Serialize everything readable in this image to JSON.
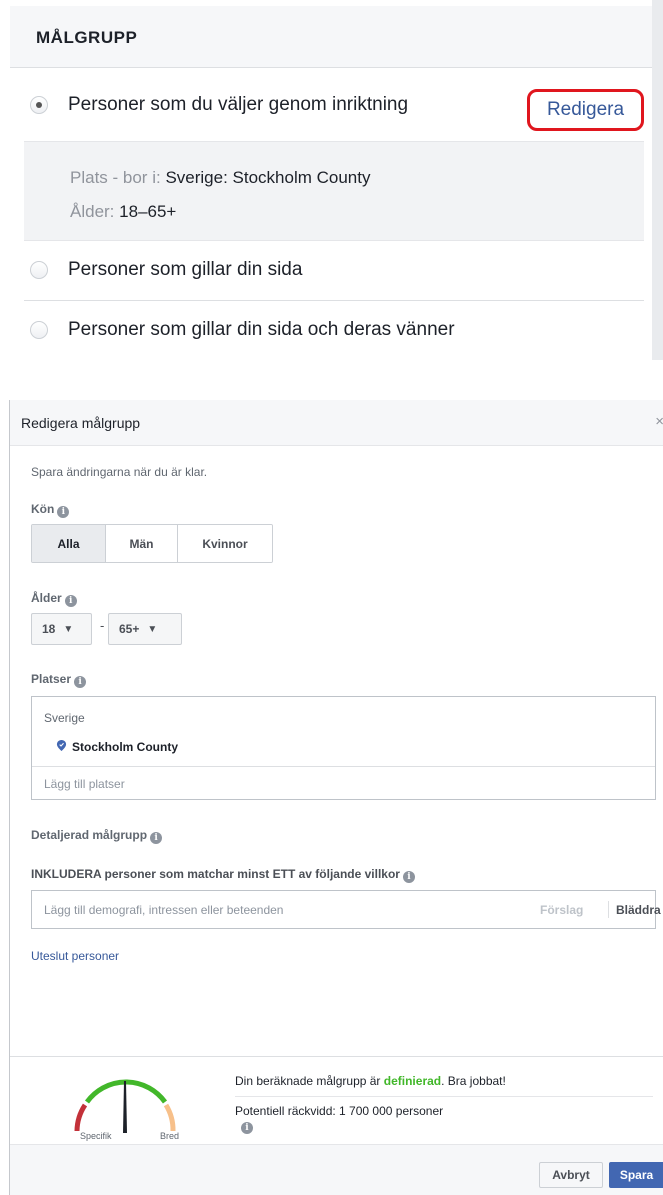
{
  "audience_panel": {
    "title": "MÅLGRUPP",
    "edit_label": "Redigera",
    "options": [
      {
        "label": "Personer som du väljer genom inriktning",
        "selected": true
      },
      {
        "label": "Personer som gillar din sida",
        "selected": false
      },
      {
        "label": "Personer som gillar din sida och deras vänner",
        "selected": false
      }
    ],
    "summary": {
      "location_key": "Plats - bor i:",
      "location_value": "Sverige: Stockholm County",
      "age_key": "Ålder:",
      "age_value": "18–65+"
    }
  },
  "modal": {
    "title": "Redigera målgrupp",
    "close_glyph": "×",
    "hint": "Spara ändringarna när du är klar.",
    "gender": {
      "label": "Kön",
      "options": [
        "Alla",
        "Män",
        "Kvinnor"
      ],
      "selected": "Alla"
    },
    "age": {
      "label": "Ålder",
      "min": "18",
      "separator": "-",
      "max": "65+"
    },
    "locations": {
      "label": "Platser",
      "country": "Sverige",
      "city": "Stockholm County",
      "placeholder": "Lägg till platser"
    },
    "detailed": {
      "label": "Detaljerad målgrupp",
      "include_label": "INKLUDERA personer som matchar minst ETT av följande villkor",
      "placeholder": "Lägg till demografi, intressen eller beteenden",
      "suggestions_label": "Förslag",
      "browse_label": "Bläddra"
    },
    "exclude_link": "Uteslut personer",
    "reach": {
      "message_prefix": "Din beräknade målgrupp är ",
      "status": "definierad",
      "message_suffix": ". Bra jobbat!",
      "potential": "Potentiell räckvidd: 1 700 000 personer",
      "gauge_left": "Specifik",
      "gauge_right": "Bred"
    },
    "footer": {
      "cancel_label": "Avbryt",
      "save_label": "Spara"
    }
  },
  "colors": {
    "link": "#365899",
    "primary": "#4267b2",
    "highlight_border": "#e0161e",
    "good": "#42b72a"
  },
  "icons": {
    "info": "info-icon",
    "location_pin": "location-pin-icon",
    "caret": "caret-down-icon",
    "close": "close-icon"
  }
}
